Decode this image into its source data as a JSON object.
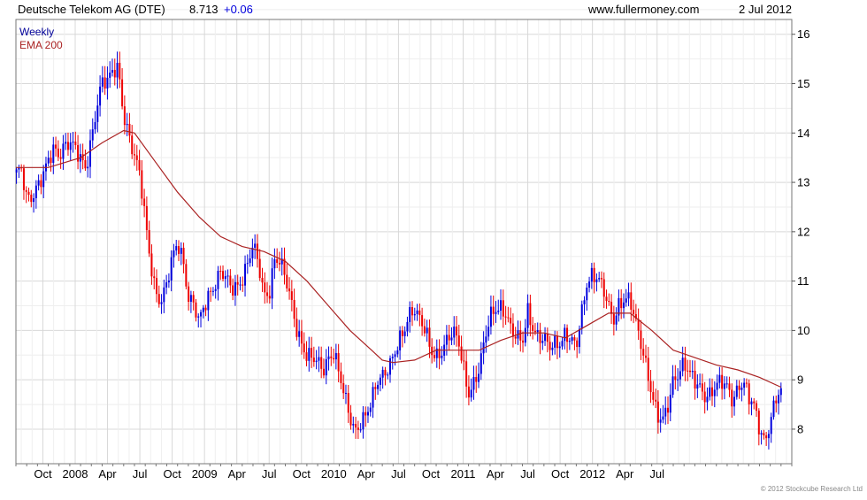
{
  "header": {
    "instrument": "Deutsche Telekom AG (DTE)",
    "last_price": "8.713",
    "change": "+0.06",
    "site": "www.fullermoney.com",
    "date": "2 Jul 2012"
  },
  "copyright": "© 2012 Stockcube Research Ltd",
  "colors": {
    "up": "#0000dd",
    "down": "#ee0000",
    "ema": "#aa2222",
    "grid": "#d8d8d8",
    "header_change": "#0000dd",
    "legend_weekly": "#000099",
    "legend_ema": "#aa2222"
  },
  "chart_data": {
    "type": "candlestick",
    "period": "weekly",
    "series": [
      {
        "name": "Weekly",
        "points": [
          [
            0,
            13.2
          ],
          [
            0.5,
            13.2
          ],
          [
            1,
            12.6
          ],
          [
            1.5,
            12.7
          ],
          [
            2,
            13
          ],
          [
            2.5,
            13.2
          ],
          [
            3,
            13.4
          ],
          [
            3.5,
            13.6
          ],
          [
            4,
            13.5
          ],
          [
            4.5,
            13.8
          ],
          [
            5,
            13.9
          ],
          [
            5.5,
            13.7
          ],
          [
            6,
            13.4
          ],
          [
            6.5,
            13.2
          ],
          [
            7,
            13.9
          ],
          [
            7.5,
            14.6
          ],
          [
            8,
            15.1
          ],
          [
            8.5,
            15
          ],
          [
            9,
            15.2
          ],
          [
            9.5,
            15.3
          ],
          [
            10,
            14.4
          ],
          [
            10.5,
            14
          ],
          [
            11,
            13.5
          ],
          [
            11.5,
            13.1
          ],
          [
            12,
            12.2
          ],
          [
            12.5,
            11.4
          ],
          [
            13,
            10.8
          ],
          [
            13.5,
            10.6
          ],
          [
            14,
            10.9
          ],
          [
            14.5,
            11.4
          ],
          [
            15,
            11.8
          ],
          [
            15.5,
            11.5
          ],
          [
            16,
            10.7
          ],
          [
            16.5,
            10.5
          ],
          [
            17,
            10.1
          ],
          [
            17.5,
            10.5
          ],
          [
            18,
            10.8
          ],
          [
            18.5,
            11
          ],
          [
            19,
            11.2
          ],
          [
            19.5,
            11
          ],
          [
            20,
            10.8
          ],
          [
            20.5,
            10.9
          ],
          [
            21,
            11.1
          ],
          [
            21.5,
            11.4
          ],
          [
            22,
            11.7
          ],
          [
            22.5,
            11.3
          ],
          [
            23,
            10.7
          ],
          [
            23.5,
            10.8
          ],
          [
            24,
            11.5
          ],
          [
            24.5,
            11.4
          ],
          [
            25,
            11
          ],
          [
            25.5,
            10.6
          ],
          [
            26,
            10.1
          ],
          [
            26.5,
            9.8
          ],
          [
            27,
            9.5
          ],
          [
            27.5,
            9.4
          ],
          [
            28,
            9.3
          ],
          [
            28.5,
            9.2
          ],
          [
            29,
            9.5
          ],
          [
            29.5,
            9.6
          ],
          [
            30,
            9.1
          ],
          [
            30.5,
            8.6
          ],
          [
            31,
            8.2
          ],
          [
            31.5,
            8
          ],
          [
            32,
            8.2
          ],
          [
            32.5,
            8.3
          ],
          [
            33,
            8.5
          ],
          [
            33.5,
            8.9
          ],
          [
            34,
            9.1
          ],
          [
            34.5,
            9.3
          ],
          [
            35,
            9.5
          ],
          [
            35.5,
            9.7
          ],
          [
            36,
            9.9
          ],
          [
            36.5,
            10.3
          ],
          [
            37,
            10.5
          ],
          [
            37.5,
            10.3
          ],
          [
            38,
            10
          ],
          [
            38.5,
            9.5
          ],
          [
            39,
            9.4
          ],
          [
            39.5,
            9.6
          ],
          [
            40,
            9.9
          ],
          [
            40.5,
            10
          ],
          [
            41,
            9.8
          ],
          [
            41.5,
            9.2
          ],
          [
            42,
            8.7
          ],
          [
            42.5,
            9
          ],
          [
            43,
            9.3
          ],
          [
            43.5,
            9.8
          ],
          [
            44,
            10.2
          ],
          [
            44.5,
            10.4
          ],
          [
            45,
            10.5
          ],
          [
            45.5,
            10.4
          ],
          [
            46,
            10
          ],
          [
            46.5,
            9.8
          ],
          [
            47,
            9.7
          ],
          [
            47.5,
            10.4
          ],
          [
            48,
            10.1
          ],
          [
            48.5,
            9.9
          ],
          [
            49,
            9.8
          ],
          [
            49.5,
            9.6
          ],
          [
            50,
            9.7
          ],
          [
            50.5,
            9.8
          ],
          [
            51,
            10
          ],
          [
            51.5,
            9.8
          ],
          [
            52,
            9.6
          ],
          [
            52.5,
            10.3
          ],
          [
            53,
            11
          ],
          [
            53.5,
            11.2
          ],
          [
            54,
            11.1
          ],
          [
            54.5,
            10.8
          ],
          [
            55,
            10.4
          ],
          [
            55.5,
            10.2
          ],
          [
            56,
            10.6
          ],
          [
            56.5,
            10.7
          ],
          [
            57,
            10.6
          ],
          [
            57.5,
            10.1
          ],
          [
            58,
            9.7
          ],
          [
            58.5,
            9.3
          ],
          [
            59,
            8.8
          ],
          [
            59.5,
            8.3
          ],
          [
            60,
            8.1
          ],
          [
            60.5,
            8.4
          ],
          [
            61,
            9
          ],
          [
            61.5,
            9.2
          ],
          [
            62,
            9.4
          ],
          [
            62.5,
            9.1
          ],
          [
            63,
            8.9
          ],
          [
            63.5,
            8.8
          ],
          [
            64,
            8.7
          ],
          [
            64.5,
            8.8
          ],
          [
            65,
            8.9
          ],
          [
            65.5,
            8.9
          ],
          [
            66,
            8.8
          ],
          [
            66.5,
            8.6
          ],
          [
            67,
            8.9
          ],
          [
            67.5,
            9
          ],
          [
            68,
            8.6
          ],
          [
            68.5,
            8.4
          ],
          [
            69,
            8
          ],
          [
            69.5,
            7.8
          ],
          [
            70,
            8.2
          ],
          [
            70.5,
            8.6
          ],
          [
            71,
            8.713
          ]
        ]
      },
      {
        "name": "EMA 200",
        "points": [
          [
            0,
            13.3
          ],
          [
            3,
            13.3
          ],
          [
            6,
            13.5
          ],
          [
            8,
            13.8
          ],
          [
            10,
            14.05
          ],
          [
            11,
            14
          ],
          [
            13,
            13.4
          ],
          [
            15,
            12.8
          ],
          [
            17,
            12.3
          ],
          [
            19,
            11.9
          ],
          [
            21,
            11.7
          ],
          [
            23,
            11.6
          ],
          [
            25,
            11.4
          ],
          [
            27,
            11
          ],
          [
            29,
            10.5
          ],
          [
            31,
            10
          ],
          [
            33,
            9.6
          ],
          [
            34,
            9.4
          ],
          [
            35,
            9.35
          ],
          [
            37,
            9.4
          ],
          [
            39,
            9.6
          ],
          [
            41,
            9.6
          ],
          [
            43,
            9.6
          ],
          [
            45,
            9.8
          ],
          [
            47,
            9.95
          ],
          [
            49,
            9.95
          ],
          [
            51,
            9.85
          ],
          [
            53,
            10.1
          ],
          [
            55,
            10.35
          ],
          [
            57,
            10.35
          ],
          [
            59,
            10
          ],
          [
            61,
            9.6
          ],
          [
            63,
            9.45
          ],
          [
            65,
            9.3
          ],
          [
            67,
            9.2
          ],
          [
            69,
            9.05
          ],
          [
            71,
            8.85
          ]
        ]
      }
    ],
    "x_tick_labels": [
      "Oct",
      "2008",
      "Apr",
      "Jul",
      "Oct",
      "2009",
      "Apr",
      "Jul",
      "Oct",
      "2010",
      "Apr",
      "Jul",
      "Oct",
      "2011",
      "Apr",
      "Jul",
      "Oct",
      "2012",
      "Apr",
      "Jul"
    ],
    "x_ticks": [
      2.5,
      5.5,
      8.5,
      11.5,
      14.5,
      17.5,
      20.5,
      23.5,
      26.5,
      29.5,
      32.5,
      35.5,
      38.5,
      41.5,
      44.5,
      47.5,
      50.5,
      53.5,
      56.5,
      59.5
    ],
    "y_ticks": [
      8,
      9,
      10,
      11,
      12,
      13,
      14,
      15,
      16
    ],
    "ylim": [
      7.3,
      16.3
    ],
    "xlim": [
      0,
      72
    ],
    "grid": true,
    "legend": {
      "position": "top-left",
      "entries": [
        "Weekly",
        "EMA 200"
      ]
    }
  }
}
